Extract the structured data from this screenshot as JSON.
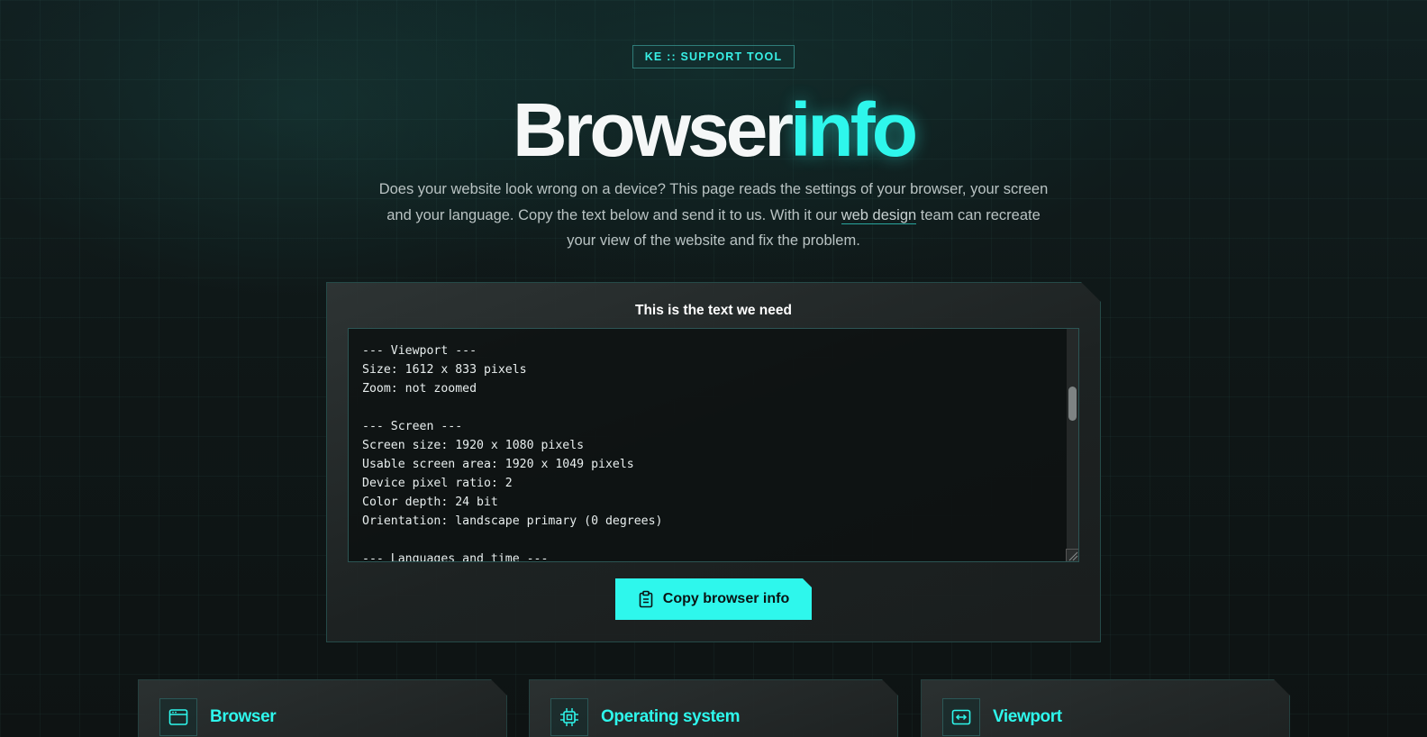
{
  "header": {
    "badge": "KE :: SUPPORT TOOL",
    "title_main": "Browser",
    "title_accent": "info",
    "intro_before_link": "Does your website look wrong on a device? This page reads the settings of your browser, your screen and your language. Copy the text below and send it to us. With it our ",
    "intro_link": "web design",
    "intro_after_link": " team can recreate your view of the website and fix the problem."
  },
  "info_card": {
    "heading": "This is the text we need",
    "text": "--- Viewport ---\nSize: 1612 x 833 pixels\nZoom: not zoomed\n\n--- Screen ---\nScreen size: 1920 x 1080 pixels\nUsable screen area: 1920 x 1049 pixels\nDevice pixel ratio: 2\nColor depth: 24 bit\nOrientation: landscape primary (0 degrees)\n\n--- Languages and time ---",
    "copy_button_label": "Copy browser info"
  },
  "sections": [
    {
      "title": "Browser",
      "icon": "browser-window-icon"
    },
    {
      "title": "Operating system",
      "icon": "cpu-chip-icon"
    },
    {
      "title": "Viewport",
      "icon": "viewport-arrows-icon"
    }
  ],
  "colors": {
    "accent": "#2ef7ec",
    "background": "#0f1414",
    "card_border": "#254a48"
  }
}
